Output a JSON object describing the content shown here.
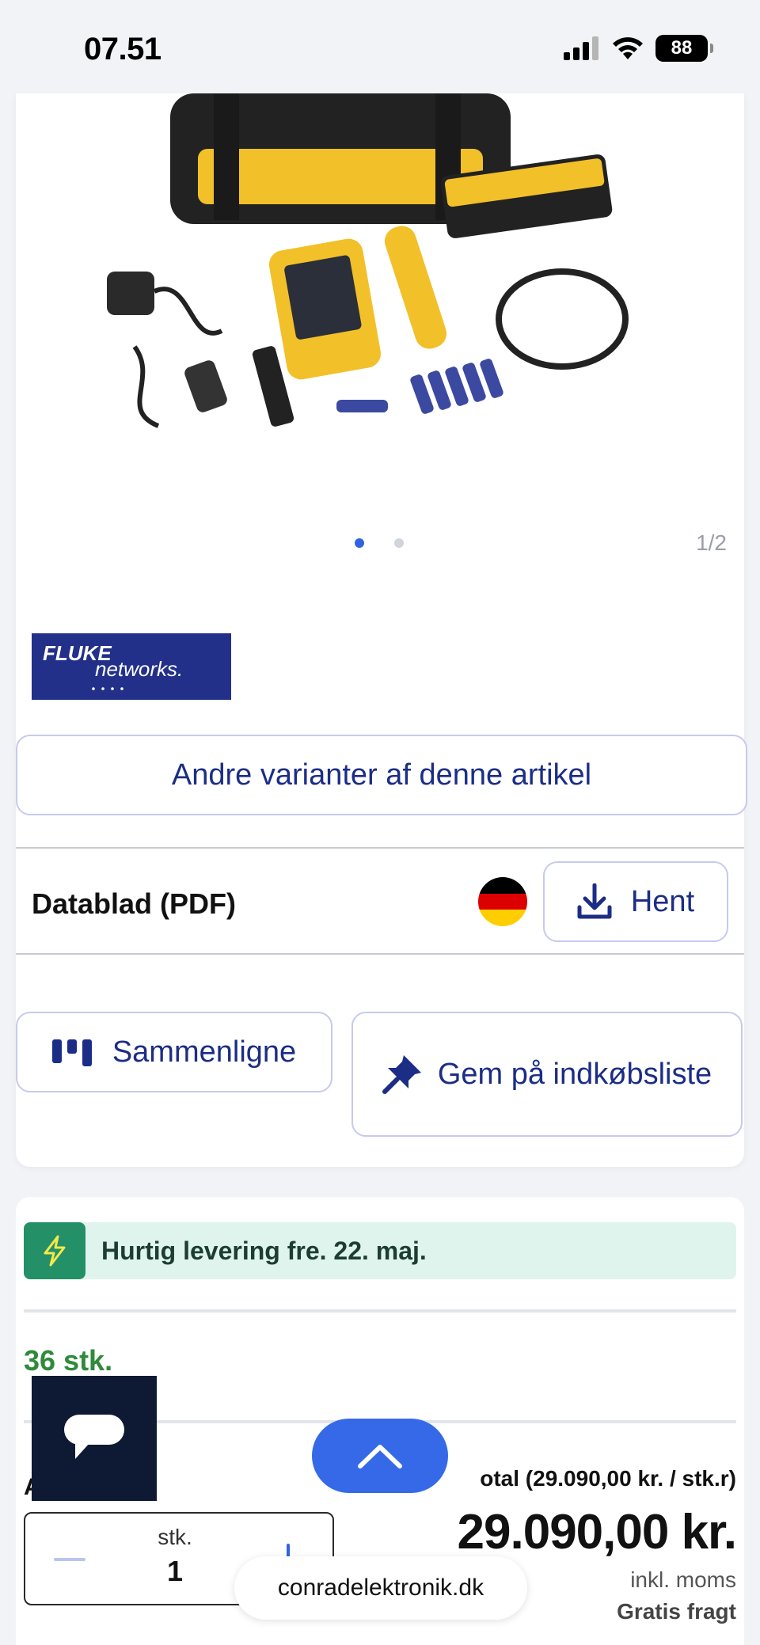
{
  "status_bar": {
    "time": "07.51",
    "battery": "88"
  },
  "product": {
    "image_counter": "1/2",
    "brand_logo_text": "FLUKE networks",
    "variants_button": "Andre varianter af denne artikel",
    "datasheet_label": "Datablad (PDF)",
    "download_button": "Hent",
    "compare_button": "Sammenligne",
    "shopping_list_button": "Gem på indkøbsliste"
  },
  "purchase": {
    "delivery": "Hurtig levering fre. 22. maj.",
    "stock": "36 stk.",
    "amount_label": "A",
    "total_label": "otal (29.090,00 kr. / stk.r)",
    "price": "29.090,00 kr.",
    "vat": "inkl. moms",
    "shipping": "Gratis fragt",
    "qty_unit": "stk.",
    "qty_value": "1"
  },
  "browser": {
    "url": "conradelektronik.dk"
  },
  "colors": {
    "accent": "#2f63e0",
    "primary_text": "#1c2d86",
    "delivery_green": "#239068",
    "stock_green": "#2f8a3b"
  }
}
